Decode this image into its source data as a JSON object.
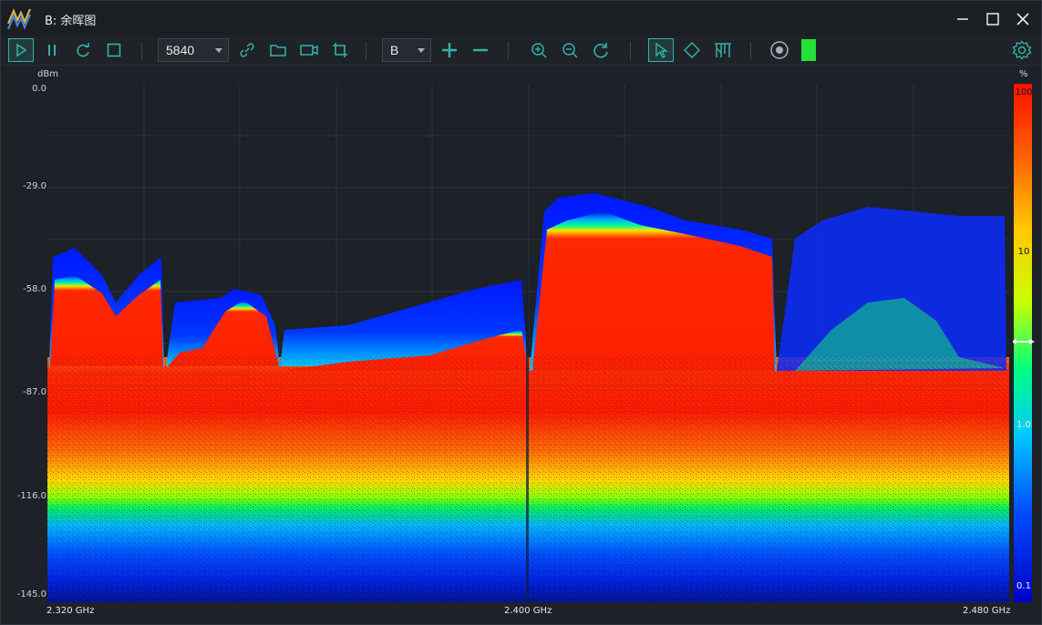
{
  "window": {
    "title": "B: 余晖图"
  },
  "toolbar": {
    "points_value": "5840",
    "trace_value": "B",
    "status_led_color": "#22e23a",
    "accent_color": "#2fb3a8",
    "icons": [
      "play-icon",
      "pause-icon",
      "loop-icon",
      "stop-icon",
      "link-icon",
      "folder-icon",
      "camera-icon",
      "crop-icon",
      "plus-icon",
      "minus-icon",
      "zoom-in-icon",
      "zoom-out-icon",
      "reset-icon",
      "cursor-icon",
      "marker-icon",
      "filter-icon",
      "record-icon",
      "gear-icon"
    ]
  },
  "plot": {
    "y_unit": "dBm",
    "y_ticks": [
      "0.0",
      "-29.0",
      "-58.0",
      "-87.0",
      "-116.0",
      "-145.0"
    ],
    "x_ticks": [
      "2.320 GHz",
      "2.400 GHz",
      "2.480 GHz"
    ],
    "colorbar_unit": "%",
    "colorbar_ticks": [
      "100",
      "10",
      "1.0",
      "0.1"
    ],
    "colormap": [
      "#0000d0",
      "#0060ff",
      "#00c8ff",
      "#00ff80",
      "#c8ff00",
      "#ffd000",
      "#ff7000",
      "#ff1a00"
    ]
  }
}
